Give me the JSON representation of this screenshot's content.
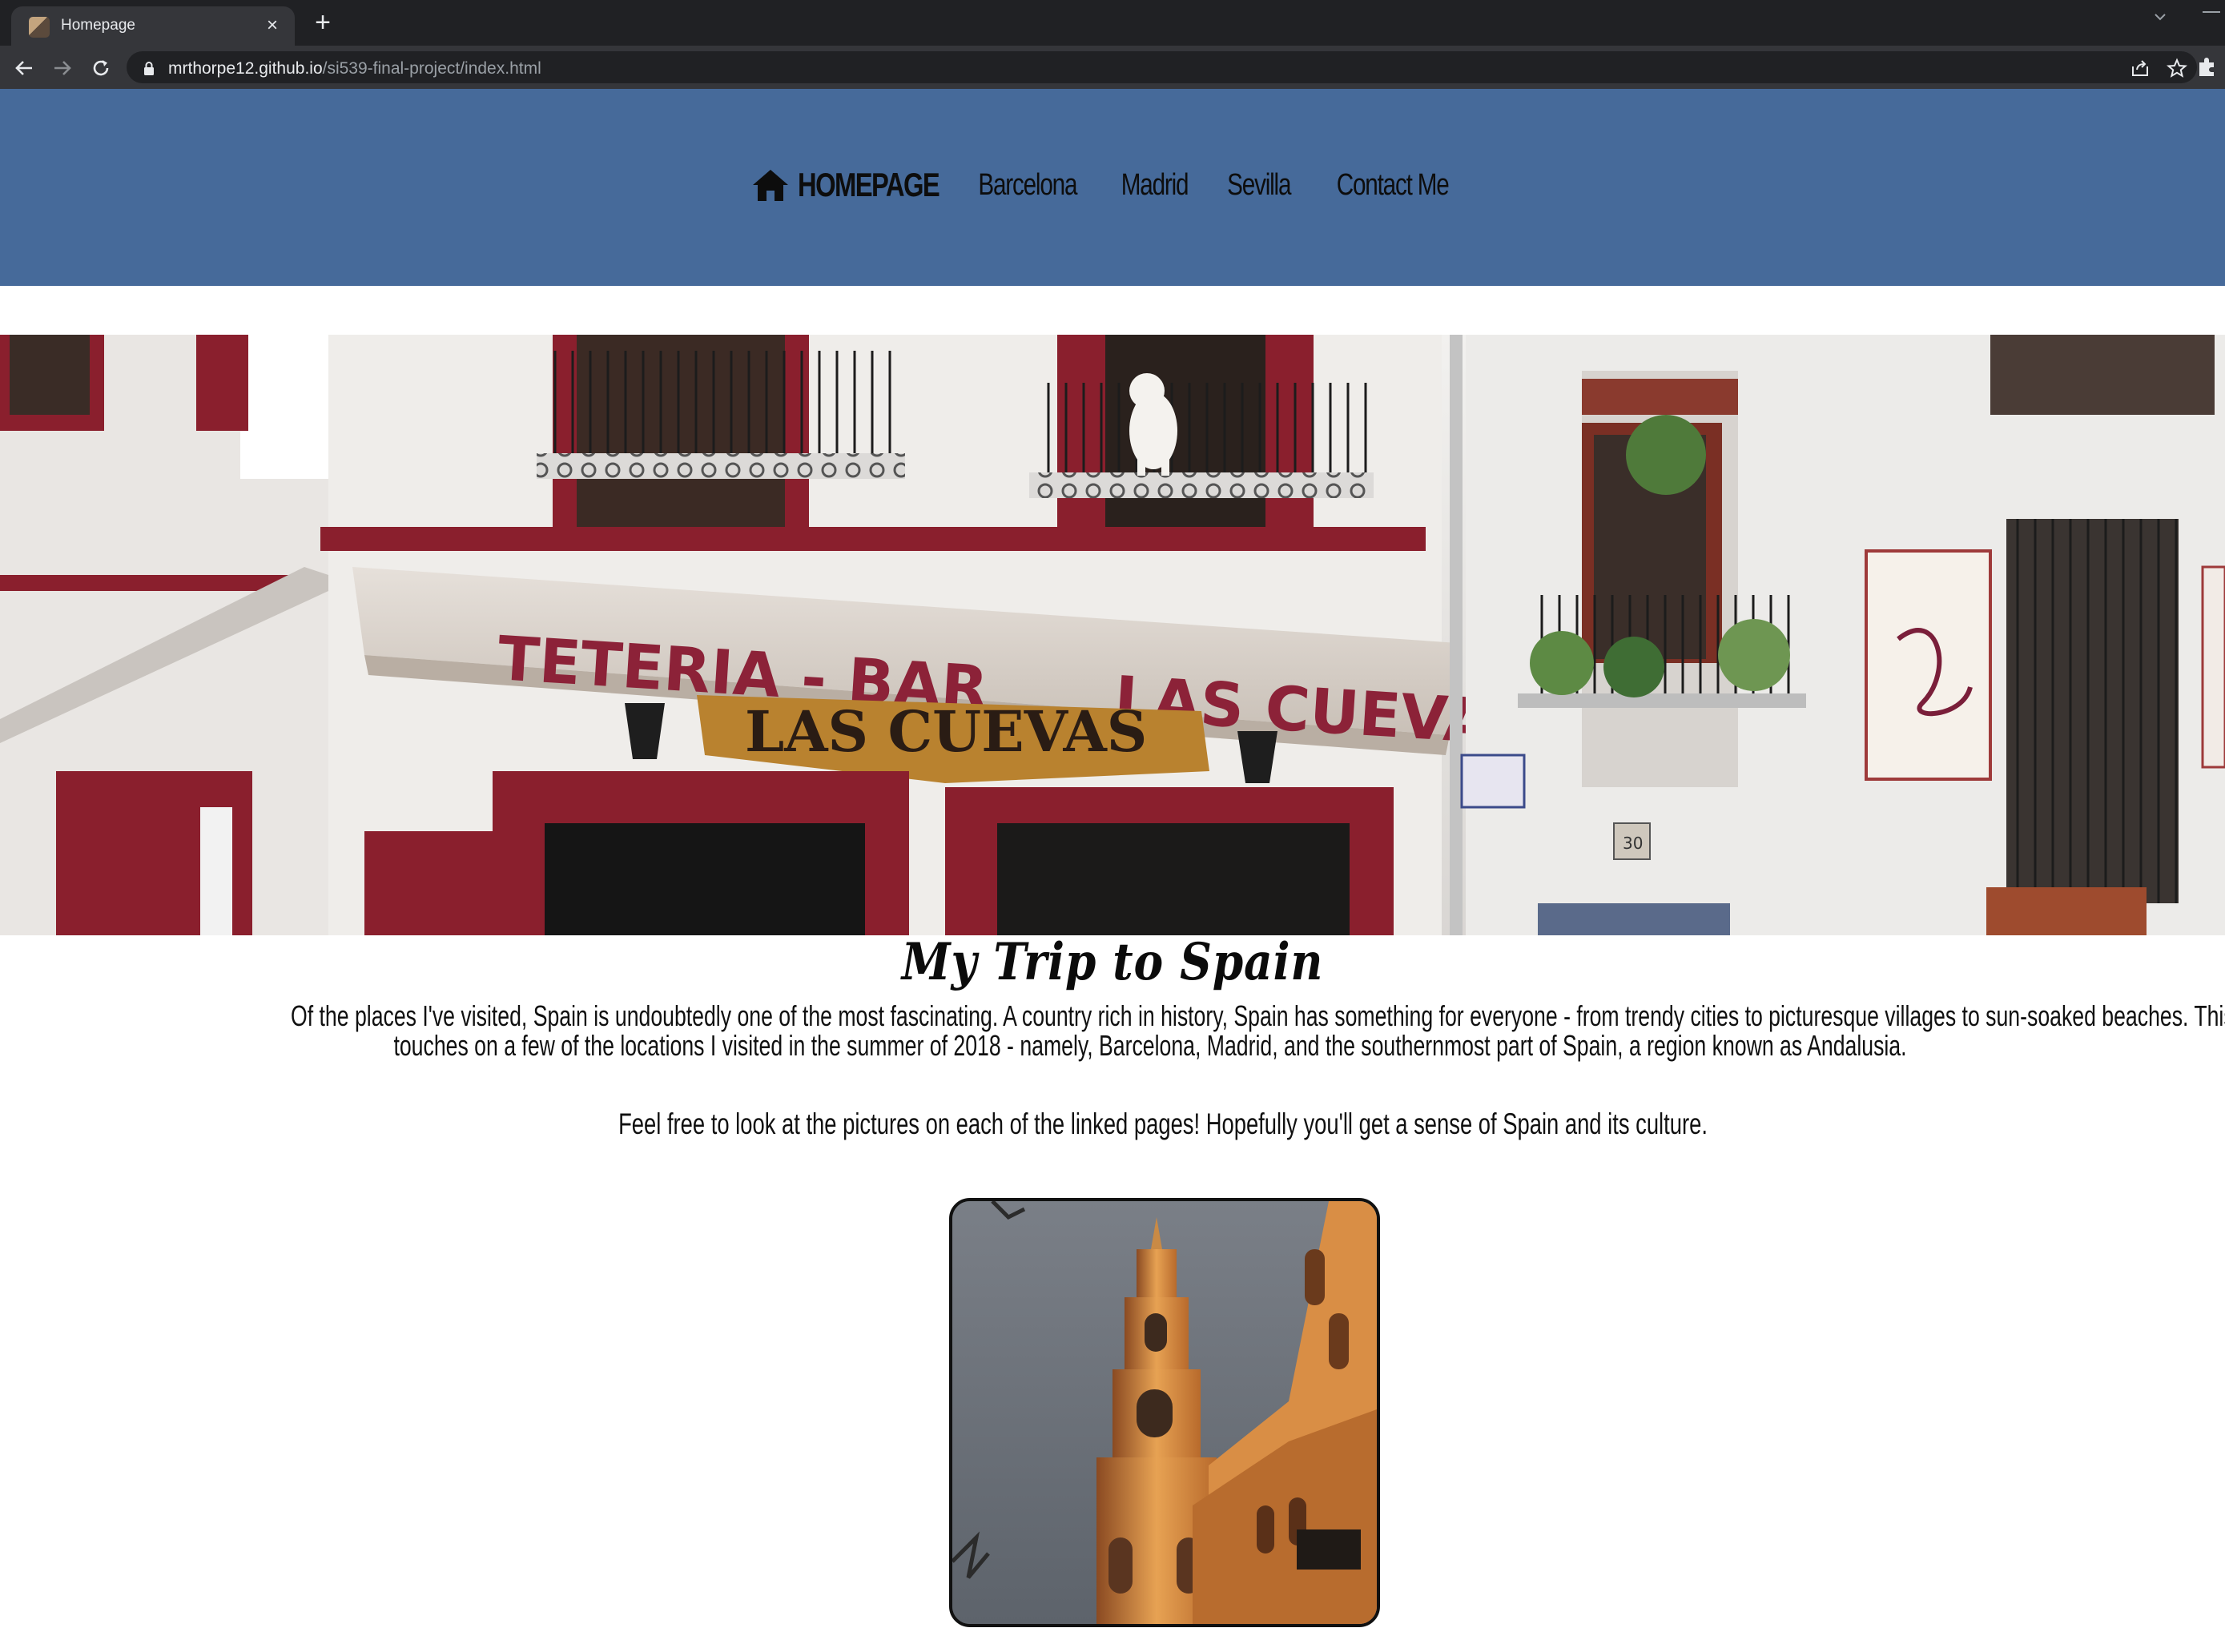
{
  "browser": {
    "tab_title": "Homepage",
    "tab_close": "×",
    "new_tab": "+",
    "url_host": "mrthorpe12.github.io",
    "url_path": "/si539-final-project/index.html"
  },
  "nav": {
    "home_label": "HOMEPAGE",
    "items": [
      {
        "label": "Barcelona"
      },
      {
        "label": "Madrid"
      },
      {
        "label": "Sevilla"
      },
      {
        "label": "Contact Me"
      }
    ]
  },
  "hero": {
    "awning_text_1": "TETERIA  -  BAR",
    "awning_text_2": "LAS CUEVAS",
    "sign_text": "LAS CUEVAS",
    "door_number": "30"
  },
  "main": {
    "title": "My Trip to Spain",
    "intro_line_1": "Of the places I've visited, Spain is undoubtedly one of the most fascinating. A country rich in history, Spain has something for everyone - from trendy cities to picturesque villages to sun-soaked beaches. This we",
    "intro_line_2": "touches on a few of the locations I visited in the summer of 2018 - namely, Barcelona, Madrid, and the southernmost part of Spain, a region known as Andalusia.",
    "intro_2": "Feel free to look at the pictures on each of the linked pages! Hopefully you'll get a sense of Spain and its culture."
  },
  "colors": {
    "header_bg": "#466a9a",
    "chrome_dark": "#202124",
    "chrome_toolbar": "#35363a",
    "awning_text": "#8c2238",
    "shutter_red": "#8a1f2d"
  }
}
